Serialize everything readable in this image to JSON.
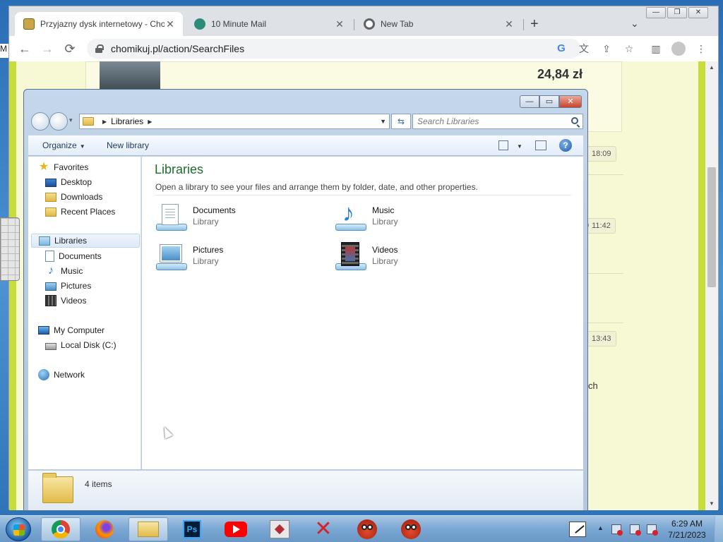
{
  "desktop": {
    "left_label_fragment": "M"
  },
  "browser": {
    "tabs": [
      {
        "title": "Przyjazny dysk internetowy - Cho",
        "active": true
      },
      {
        "title": "10 Minute Mail",
        "active": false
      },
      {
        "title": "New Tab",
        "active": false
      }
    ],
    "tab_close_glyph": "✕",
    "new_tab_glyph": "+",
    "tab_search_glyph": "⌄",
    "window_controls": {
      "minimize": "—",
      "maximize": "❐",
      "close": "✕"
    },
    "nav": {
      "back": "←",
      "forward": "→",
      "reload": "⟳"
    },
    "url": "chomikuj.pl/action/SearchFiles",
    "toolbar_icons": {
      "google": "G",
      "translate": "文",
      "share": "⇪",
      "bookmark": "☆",
      "sidepanel": "▥",
      "menu": "⋮"
    }
  },
  "webpage": {
    "price": "24,84 zł",
    "times": [
      "18:09",
      "11:42",
      "13:43"
    ],
    "time_partials": [
      "9"
    ],
    "fragment_text": "ch"
  },
  "explorer": {
    "window_controls": {
      "minimize": "—",
      "maximize": "▭",
      "close": "✕"
    },
    "history_glyph": "▾",
    "breadcrumb": [
      "Libraries"
    ],
    "address_dropdown_glyph": "▼",
    "refresh_glyph": "⇆",
    "search_placeholder": "Search Libraries",
    "commands": {
      "organize": "Organize",
      "organize_arrow": "▼",
      "new_library": "New library",
      "view_arrow": "▼",
      "help": "?"
    },
    "nav": {
      "favorites": "Favorites",
      "favorites_items": [
        "Desktop",
        "Downloads",
        "Recent Places"
      ],
      "libraries": "Libraries",
      "libraries_items": [
        "Documents",
        "Music",
        "Pictures",
        "Videos"
      ],
      "computer": "My Computer",
      "computer_items": [
        "Local Disk (C:)"
      ],
      "network": "Network",
      "star_glyph": "★",
      "note_glyph": "♪"
    },
    "content": {
      "title": "Libraries",
      "subtitle": "Open a library to see your files and arrange them by folder, date, and other properties.",
      "libraries": [
        {
          "name": "Documents",
          "type": "Library"
        },
        {
          "name": "Music",
          "type": "Library"
        },
        {
          "name": "Pictures",
          "type": "Library"
        },
        {
          "name": "Videos",
          "type": "Library"
        }
      ],
      "note_glyph": "♪"
    },
    "details": {
      "items_count": "4 items"
    }
  },
  "taskbar": {
    "ps_label": "Ps",
    "x_label": "✕",
    "tray_arrow": "▲",
    "clock": {
      "time": "6:29 AM",
      "date": "7/21/2023"
    }
  }
}
